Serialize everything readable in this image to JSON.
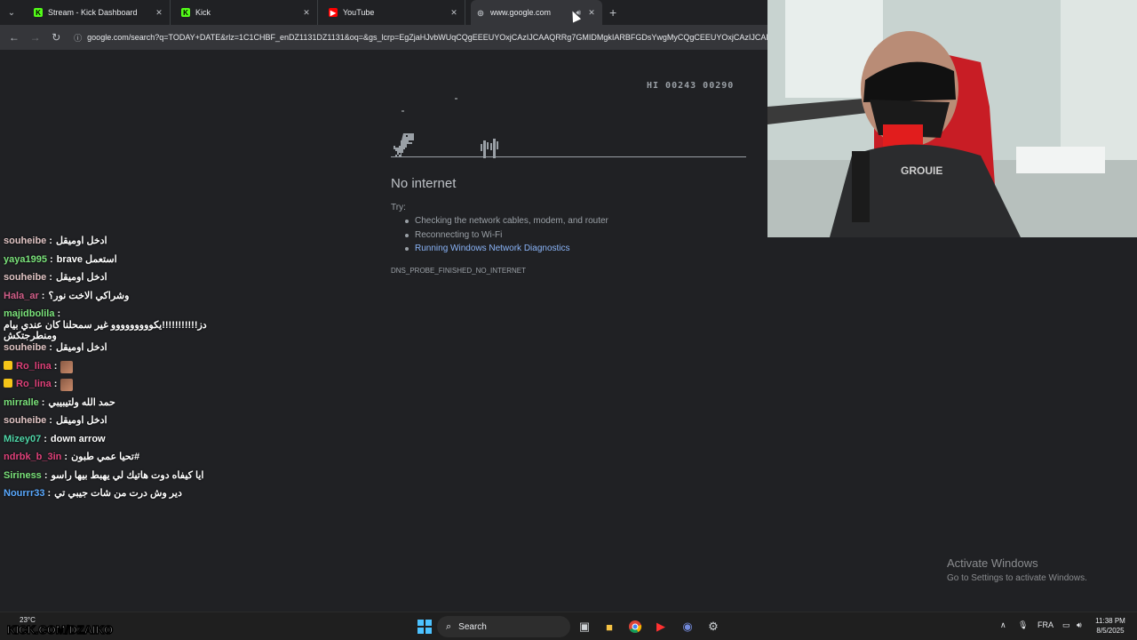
{
  "browser": {
    "tabs": [
      {
        "title": "Stream - Kick Dashboard",
        "favicon": "kick-icon",
        "color": "#53fc18"
      },
      {
        "title": "Kick",
        "favicon": "kick-icon",
        "color": "#53fc18"
      },
      {
        "title": "YouTube",
        "favicon": "youtube-icon",
        "color": "#ff0000"
      },
      {
        "title": "www.google.com",
        "favicon": "globe-icon",
        "active": true,
        "audio": true
      }
    ],
    "new_tab": "+",
    "url": "google.com/search?q=TODAY+DATE&rlz=1C1CHBF_enDZ1131DZ1131&oq=&gs_lcrp=EgZjaHJvbWUqCQgEEEUYOxjCAzIJCAAQRRg7GMIDMgkIARBFGDsYwgMyCQgCEEUYOxjCAzIJCAM"
  },
  "error_page": {
    "hi_score": "HI 00243  00290",
    "title": "No internet",
    "try_label": "Try:",
    "suggestions": [
      "Checking the network cables, modem, and router",
      "Reconnecting to Wi-Fi",
      "Running Windows Network Diagnostics"
    ],
    "code": "DNS_PROBE_FINISHED_NO_INTERNET"
  },
  "chat": [
    {
      "user": "souheibe",
      "color": "#e0c4c4",
      "text": "ادخل اوميقل"
    },
    {
      "user": "yaya1995",
      "color": "#7be37b",
      "text": "brave استعمل"
    },
    {
      "user": "souheibe",
      "color": "#e0c4c4",
      "text": "ادخل اوميقل"
    },
    {
      "user": "Hala_ar",
      "color": "#d35f8a",
      "text": "وشراكي الاخت نور؟"
    },
    {
      "user": "majidbolila",
      "color": "#7be37b",
      "text": "دز!!!!!!!!!!!يكووووووووو غير سمحلنا كان عندي بيام ومنطرجتكش",
      "two": true
    },
    {
      "user": "souheibe",
      "color": "#e0c4c4",
      "text": "ادخل اوميقل"
    },
    {
      "user": "Ro_lina",
      "color": "#e0417a",
      "text": "",
      "badge": true,
      "emote": true
    },
    {
      "user": "Ro_lina",
      "color": "#e0417a",
      "text": "",
      "badge": true,
      "emote": true
    },
    {
      "user": "mirralle",
      "color": "#7be37b",
      "text": "حمد الله ولتيبيبي"
    },
    {
      "user": "souheibe",
      "color": "#e0c4c4",
      "text": "ادخل اوميقل"
    },
    {
      "user": "Mizey07",
      "color": "#4fd6a8",
      "text": "down arrow"
    },
    {
      "user": "ndrbk_b_3in",
      "color": "#e0417a",
      "text": "تحيا عمي طبون#"
    },
    {
      "user": "Siriness",
      "color": "#7be37b",
      "text": "ايا كيفاه دوت هاتيك لي يهبط بيها راسو"
    },
    {
      "user": "Nourrr33",
      "color": "#5aa9ff",
      "text": "دير وش درت من شات جيبي تي"
    }
  ],
  "windows": {
    "activate_title": "Activate Windows",
    "activate_sub": "Go to Settings to activate Windows.",
    "weather": "23°C",
    "kick_url": "KICK.COM/DZAIKO",
    "search_label": "Search",
    "lang": "FRA",
    "time": "11:38 PM",
    "date": "8/5/2025"
  }
}
